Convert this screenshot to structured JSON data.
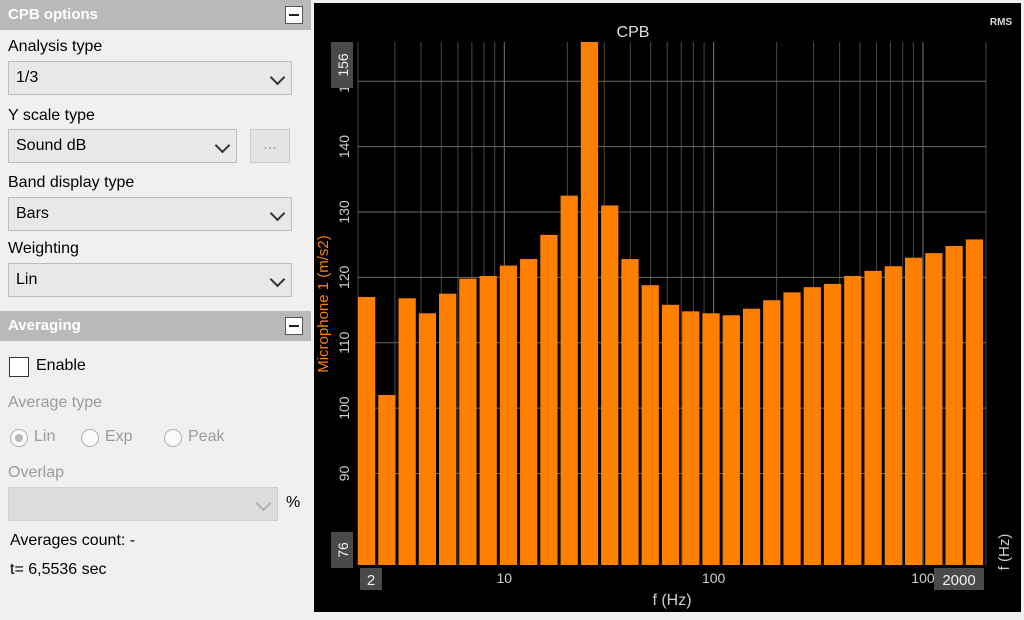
{
  "cpb_options": {
    "title": "CPB options",
    "analysis_type": {
      "label": "Analysis type",
      "value": "1/3"
    },
    "y_scale_type": {
      "label": "Y scale type",
      "value": "Sound dB",
      "more_button": "..."
    },
    "band_display_type": {
      "label": "Band display type",
      "value": "Bars"
    },
    "weighting": {
      "label": "Weighting",
      "value": "Lin"
    }
  },
  "averaging": {
    "title": "Averaging",
    "enable": {
      "label": "Enable",
      "checked": false
    },
    "average_type": {
      "label": "Average type",
      "options": [
        "Lin",
        "Exp",
        "Peak"
      ],
      "selected": "Lin"
    },
    "overlap": {
      "label": "Overlap",
      "value": "",
      "unit": "%"
    },
    "averages_count": "Averages count: -",
    "time": "t= 6,5536 sec"
  },
  "colors": {
    "bar": "#ff8000",
    "plot_bg": "#000000",
    "grid": "#4a4a4a",
    "ylabel": "#ff8000"
  },
  "chart_data": {
    "type": "bar",
    "title": "CPB",
    "badge": "RMS",
    "xlabel": "f (Hz)",
    "ylabel": "Microphone 1 (m/s2)",
    "xscale": "log",
    "x_tick_labels": [
      "10",
      "100",
      "100"
    ],
    "x_range_labels": {
      "min": "2",
      "max": "2000"
    },
    "y_tick_labels": [
      "90",
      "100",
      "110",
      "120",
      "130",
      "140",
      "150"
    ],
    "y_range_labels": {
      "min": "76",
      "max": "156"
    },
    "ylim": [
      76,
      156
    ],
    "xlim": [
      2,
      2000
    ],
    "right_axis_label": "f (Hz)",
    "x": [
      2,
      2.5,
      3.15,
      4,
      5,
      6.3,
      8,
      10,
      12.5,
      16,
      20,
      25,
      31.5,
      40,
      50,
      63,
      80,
      100,
      125,
      160,
      200,
      250,
      315,
      400,
      500,
      630,
      800,
      1000,
      1250,
      1600,
      2000
    ],
    "values": [
      117,
      102,
      116.8,
      114.5,
      117.5,
      119.8,
      120.2,
      121.8,
      122.8,
      126.5,
      132.5,
      156,
      131,
      122.8,
      118.8,
      115.8,
      114.8,
      114.5,
      114.2,
      115.2,
      116.5,
      117.7,
      118.5,
      119,
      120.2,
      121,
      121.7,
      123,
      123.7,
      124.8,
      125.8
    ],
    "grid": true
  }
}
